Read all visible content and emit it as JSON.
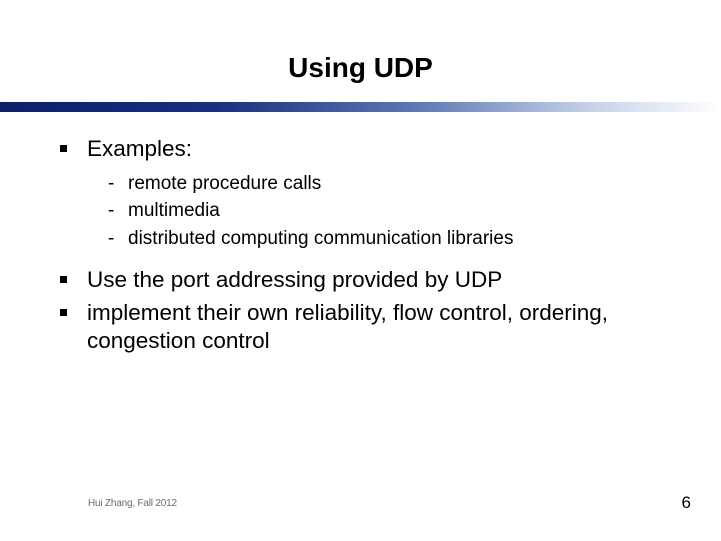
{
  "title": "Using UDP",
  "bullets": {
    "b1": {
      "text": "Examples:"
    },
    "b1_sub": {
      "s1": "remote procedure calls",
      "s2": "multimedia",
      "s3": "distributed computing communication libraries"
    },
    "b2": {
      "text": "Use the port addressing provided by UDP"
    },
    "b3": {
      "text": "implement their own reliability, flow control, ordering, congestion control"
    }
  },
  "footer": {
    "author": "Hui Zhang, Fall 2012",
    "page": "6"
  }
}
